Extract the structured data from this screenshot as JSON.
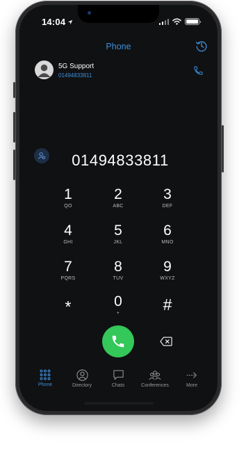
{
  "status_bar": {
    "time": "14:04"
  },
  "header": {
    "title": "Phone"
  },
  "contact": {
    "name": "5G Support",
    "number": "01494833811"
  },
  "dialer": {
    "number": "01494833811"
  },
  "keypad": [
    {
      "digit": "1",
      "letters": "QO"
    },
    {
      "digit": "2",
      "letters": "ABC"
    },
    {
      "digit": "3",
      "letters": "DEF"
    },
    {
      "digit": "4",
      "letters": "GHI"
    },
    {
      "digit": "5",
      "letters": "JKL"
    },
    {
      "digit": "6",
      "letters": "MNO"
    },
    {
      "digit": "7",
      "letters": "PQRS"
    },
    {
      "digit": "8",
      "letters": "TUV"
    },
    {
      "digit": "9",
      "letters": "WXYZ"
    },
    {
      "digit": "*",
      "letters": ""
    },
    {
      "digit": "0",
      "letters": "+"
    },
    {
      "digit": "#",
      "letters": ""
    }
  ],
  "tabs": [
    {
      "label": "Phone",
      "icon": "keypad-grid-icon",
      "active": true
    },
    {
      "label": "Directory",
      "icon": "person-circle-icon",
      "active": false
    },
    {
      "label": "Chats",
      "icon": "chat-bubble-icon",
      "active": false
    },
    {
      "label": "Conferences",
      "icon": "people-group-icon",
      "active": false
    },
    {
      "label": "More",
      "icon": "arrow-right-icon",
      "active": false
    }
  ],
  "colors": {
    "accent": "#3d8fd9",
    "call_green": "#34c759",
    "background": "#101113"
  }
}
